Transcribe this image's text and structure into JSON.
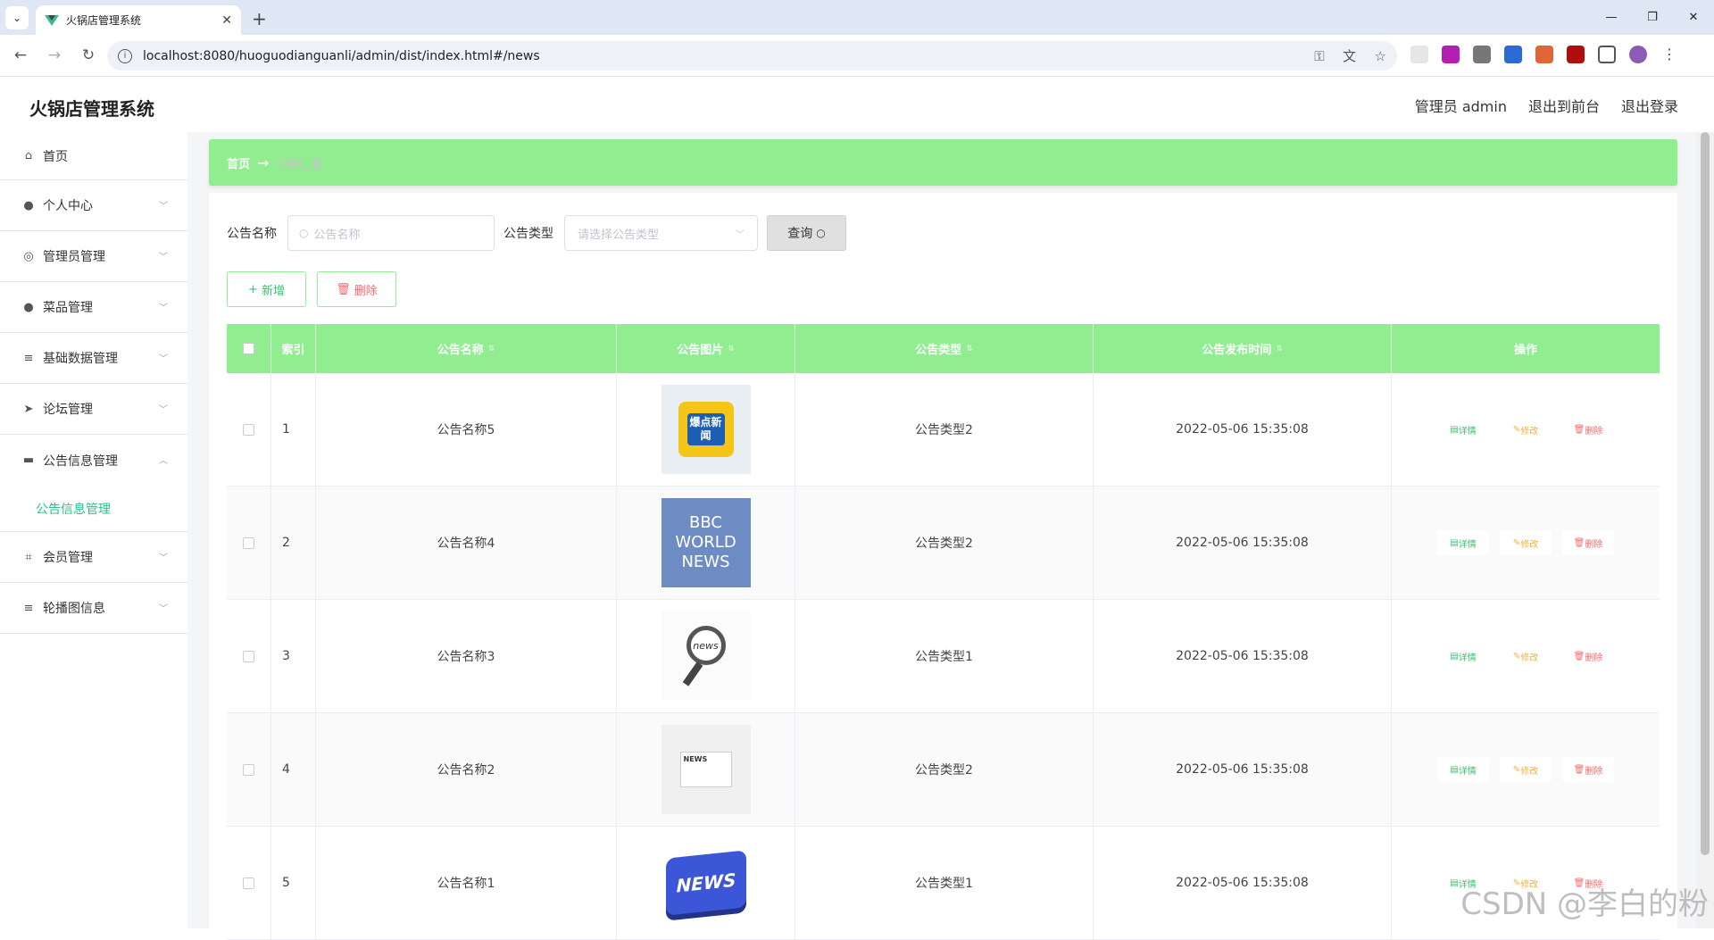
{
  "browser": {
    "tab_title": "火锅店管理系统",
    "url": "localhost:8080/huoguodianguanli/admin/dist/index.html#/news"
  },
  "header": {
    "title": "火锅店管理系统",
    "admin_label": "管理员 admin",
    "back_front": "退出到前台",
    "logout": "退出登录"
  },
  "sidebar": {
    "items": [
      {
        "label": "首页",
        "icon": "home-icon"
      },
      {
        "label": "个人中心",
        "icon": "user-icon"
      },
      {
        "label": "管理员管理",
        "icon": "compass-icon"
      },
      {
        "label": "菜品管理",
        "icon": "user-icon"
      },
      {
        "label": "基础数据管理",
        "icon": "list-icon"
      },
      {
        "label": "论坛管理",
        "icon": "send-icon"
      },
      {
        "label": "公告信息管理",
        "icon": "briefcase-icon"
      },
      {
        "label": "会员管理",
        "icon": "crop-icon"
      },
      {
        "label": "轮播图信息",
        "icon": "list-icon"
      }
    ],
    "sub_active": "公告信息管理"
  },
  "breadcrumb": {
    "home": "首页",
    "sep": "→",
    "current": "公告信息"
  },
  "search": {
    "name_label": "公告名称",
    "name_placeholder": "公告名称",
    "type_label": "公告类型",
    "type_placeholder": "请选择公告类型",
    "query_label": "查询"
  },
  "actions": {
    "add_label": "新增",
    "delete_label": "删除"
  },
  "table": {
    "headers": {
      "index": "索引",
      "name": "公告名称",
      "image": "公告图片",
      "type": "公告类型",
      "time": "公告发布时间",
      "ops": "操作"
    },
    "op_labels": {
      "detail": "详情",
      "edit": "修改",
      "delete": "删除"
    },
    "rows": [
      {
        "index": "1",
        "name": "公告名称5",
        "type": "公告类型2",
        "time": "2022-05-06 15:35:08",
        "img_text": "爆点新闻"
      },
      {
        "index": "2",
        "name": "公告名称4",
        "type": "公告类型2",
        "time": "2022-05-06 15:35:08",
        "img_text": "BBC WORLD NEWS"
      },
      {
        "index": "3",
        "name": "公告名称3",
        "type": "公告类型1",
        "time": "2022-05-06 15:35:08",
        "img_text": "news"
      },
      {
        "index": "4",
        "name": "公告名称2",
        "type": "公告类型2",
        "time": "2022-05-06 15:35:08",
        "img_text": "NEWS"
      },
      {
        "index": "5",
        "name": "公告名称1",
        "type": "公告类型1",
        "time": "2022-05-06 15:35:08",
        "img_text": "NEWS"
      }
    ]
  },
  "watermark": "CSDN @李白的粉",
  "colors": {
    "accent_green": "#90ee90",
    "active_text": "#2fbf8f"
  }
}
